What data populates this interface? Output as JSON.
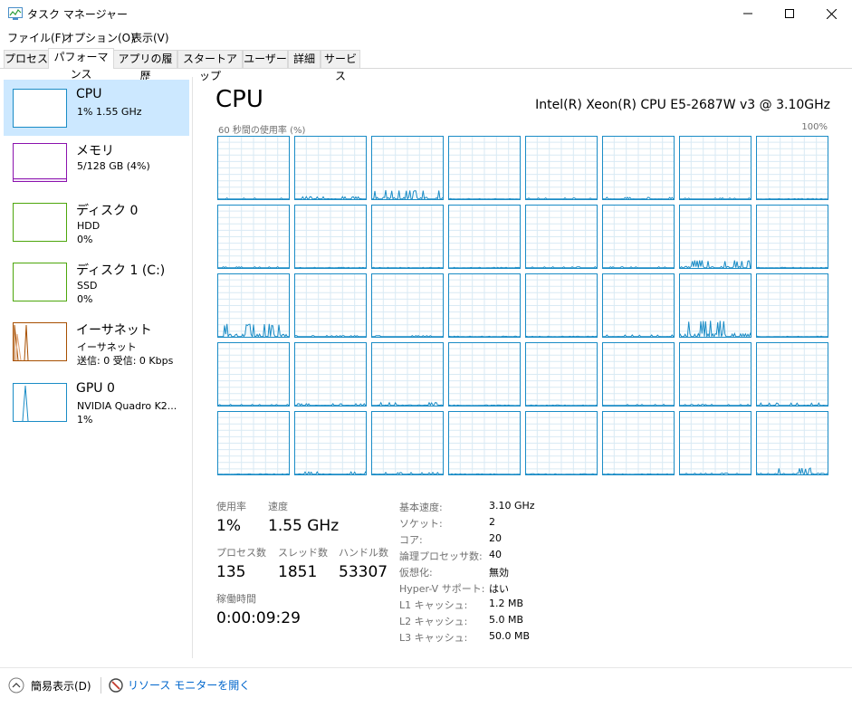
{
  "window": {
    "title": "タスク マネージャー"
  },
  "menu": [
    "ファイル(F)",
    "オプション(O)",
    "表示(V)"
  ],
  "tabs": [
    {
      "label": "プロセス"
    },
    {
      "label": "パフォーマンス",
      "active": true
    },
    {
      "label": "アプリの履歴"
    },
    {
      "label": "スタートアップ"
    },
    {
      "label": "ユーザー"
    },
    {
      "label": "詳細"
    },
    {
      "label": "サービス"
    }
  ],
  "sidebar": {
    "items": [
      {
        "name": "CPU",
        "line2": "1%  1.55 GHz",
        "line3": "",
        "color": "#1a8cc6"
      },
      {
        "name": "メモリ",
        "line2": "5/128 GB (4%)",
        "line3": "",
        "color": "#8b12ae"
      },
      {
        "name": "ディスク 0",
        "line2": "HDD",
        "line3": "0%",
        "color": "#4da60c"
      },
      {
        "name": "ディスク 1 (C:)",
        "line2": "SSD",
        "line3": "0%",
        "color": "#4da60c"
      },
      {
        "name": "イーサネット",
        "line2": "イーサネット",
        "line3": "送信: 0 受信: 0 Kbps",
        "color": "#a74f01"
      },
      {
        "name": "GPU 0",
        "line2": "NVIDIA Quadro K2...",
        "line3": "1%",
        "color": "#1a8cc6"
      }
    ]
  },
  "main": {
    "title": "CPU",
    "model": "Intel(R) Xeon(R) CPU E5-2687W v3 @ 3.10GHz",
    "chart_caption": "60 秒間の使用率 (%)",
    "chart_max": "100%"
  },
  "chart_data": {
    "type": "line",
    "title": "60 秒間の使用率 (%)",
    "ylim": [
      0,
      100
    ],
    "grid": true,
    "logical_processors": 40,
    "note_values": "per-core utilization sparklines, values in % (60 samples each, estimated)",
    "cores_peak": [
      2,
      4,
      14,
      1,
      2,
      3,
      2,
      1,
      2,
      1,
      1,
      1,
      2,
      2,
      12,
      1,
      20,
      2,
      2,
      1,
      1,
      3,
      25,
      1,
      2,
      3,
      5,
      1,
      1,
      2,
      2,
      4,
      1,
      4,
      3,
      1,
      1,
      1,
      2,
      10
    ]
  },
  "stats": {
    "usage_label": "使用率",
    "usage_value": "1%",
    "speed_label": "速度",
    "speed_value": "1.55 GHz",
    "proc_label": "プロセス数",
    "proc_value": "135",
    "thread_label": "スレッド数",
    "thread_value": "1851",
    "handle_label": "ハンドル数",
    "handle_value": "53307",
    "uptime_label": "稼働時間",
    "uptime_value": "0:00:09:29"
  },
  "specs": [
    {
      "k": "基本速度:",
      "v": "3.10 GHz"
    },
    {
      "k": "ソケット:",
      "v": "2"
    },
    {
      "k": "コア:",
      "v": "20"
    },
    {
      "k": "論理プロセッサ数:",
      "v": "40"
    },
    {
      "k": "仮想化:",
      "v": "無効"
    },
    {
      "k": "Hyper-V サポート:",
      "v": "はい"
    },
    {
      "k": "L1 キャッシュ:",
      "v": "1.2 MB"
    },
    {
      "k": "L2 キャッシュ:",
      "v": "5.0 MB"
    },
    {
      "k": "L3 キャッシュ:",
      "v": "50.0 MB"
    }
  ],
  "footer": {
    "fewer_details": "簡易表示(D)",
    "resource_monitor": "リソース モニターを開く"
  }
}
